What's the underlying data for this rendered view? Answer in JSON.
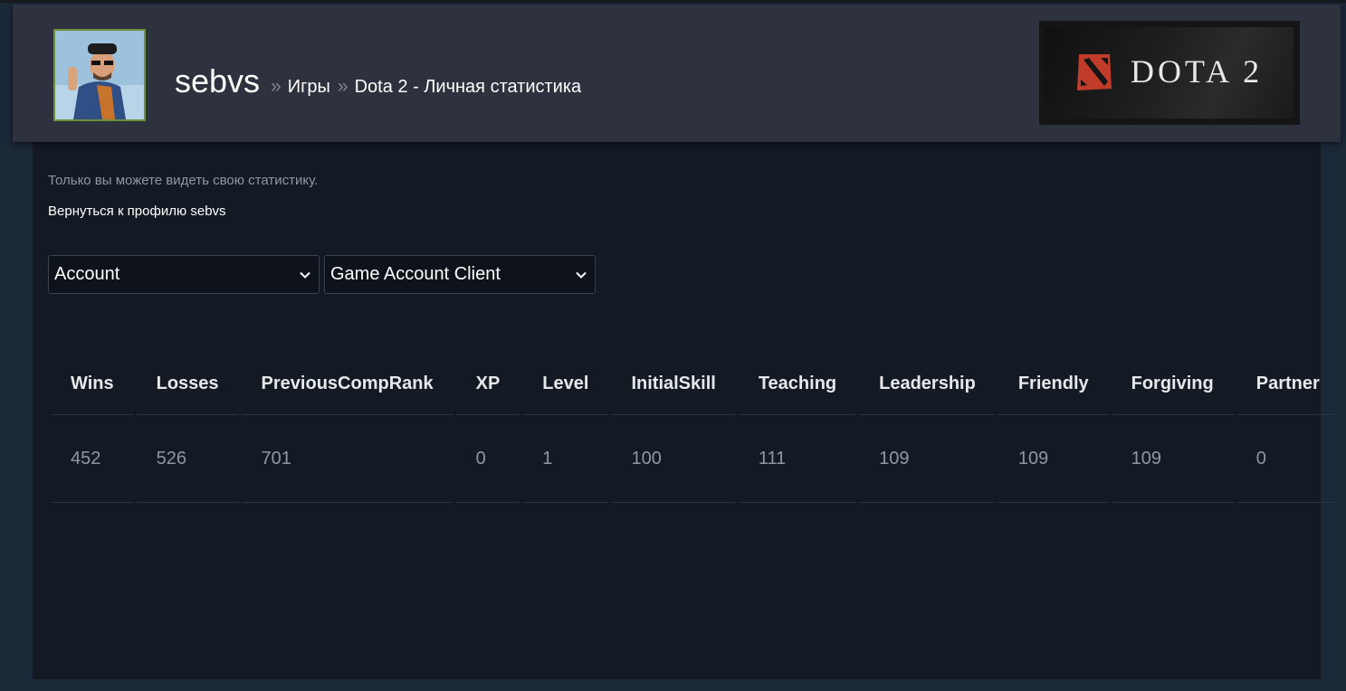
{
  "header": {
    "username": "sebvs",
    "breadcrumb_separator": "»",
    "breadcrumb_games": "Игры",
    "breadcrumb_page": "Dota 2 - Личная статистика",
    "logo_text": "DOTA 2"
  },
  "notice": "Только вы можете видеть свою статистику.",
  "back_link": "Вернуться к профилю sebvs",
  "filters": {
    "category_selected": "Account",
    "source_selected": "Game Account Client"
  },
  "stats_table": {
    "headers": [
      "Wins",
      "Losses",
      "PreviousCompRank",
      "XP",
      "Level",
      "InitialSkill",
      "Teaching",
      "Leadership",
      "Friendly",
      "Forgiving",
      "Partner"
    ],
    "values": [
      "452",
      "526",
      "701",
      "0",
      "1",
      "100",
      "111",
      "109",
      "109",
      "109",
      "0"
    ]
  },
  "colors": {
    "page_background": "#1b2838",
    "header_background": "#2e323e",
    "content_background": "#131a24",
    "avatar_border": "#6e8f3c",
    "dota_logo_red": "#c23c2a"
  }
}
